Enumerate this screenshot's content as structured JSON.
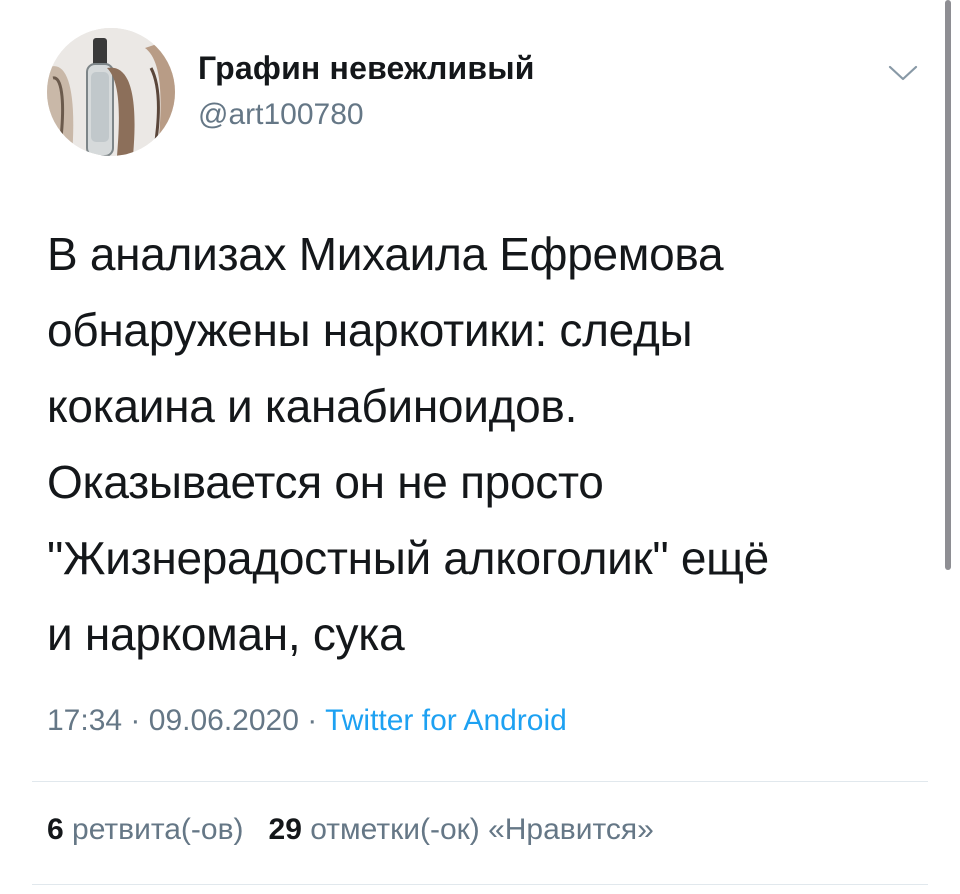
{
  "author": {
    "display_name": "Графин невежливый",
    "handle": "@art100780",
    "avatar_icon": "avatar-photo"
  },
  "tweet": {
    "text": "В анализах Михаила Ефремова\nобнаружены наркотики: следы\nкокаина и канабиноидов.\nОказывается он не просто\n\"Жизнерадостный алкоголик\" ещё\nи наркоман, сука",
    "time": "17:34",
    "date": "09.06.2020",
    "separator": "·",
    "source": "Twitter for Android"
  },
  "stats": {
    "retweets_count": "6",
    "retweets_label": "ретвита(-ов)",
    "likes_count": "29",
    "likes_label": "отметки(-ок) «Нравится»"
  },
  "colors": {
    "text_primary": "#14171a",
    "text_secondary": "#657786",
    "link": "#1da1f2",
    "divider": "#e1e8ed",
    "scrollbar": "#8e8e93"
  },
  "icons": {
    "menu": "chevron-down-icon"
  }
}
